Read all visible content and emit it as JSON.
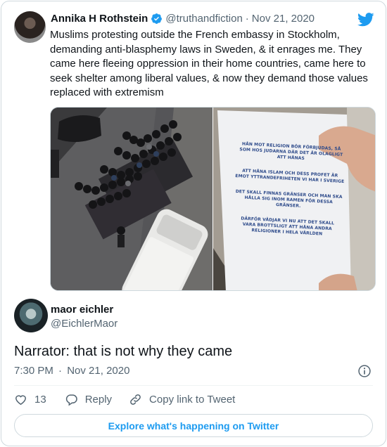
{
  "quoted_tweet": {
    "author_name": "Annika H Rothstein",
    "handle": "@truthandfiction",
    "separator": "·",
    "date": "Nov 21, 2020",
    "text": "Muslims protesting outside the French embassy in Stockholm, demanding anti-blasphemy laws in Sweden, & it enrages me. They came here fleeing oppression in their home countries, came here to seek shelter among liberal values, & now they demand those values replaced with extremism",
    "sign_text": [
      "HÅN MOT RELIGION BÖR FÖRBJUDAS, SÅ",
      "SOM HOS JUDARNA DÄR DET ÄR OLAGLIGT",
      "ATT HÅNAS",
      "ATT HÅNA ISLAM OCH DESS PROFET ÄR",
      "EMOT YTTRANDEFRIHETEN VI HAR I SVERIGE",
      "DET SKALL FINNAS GRÄNSER OCH MAN SKA",
      "HÅLLA SIG INOM RAMEN FÖR DESSA",
      "GRÄNSER.",
      "DÄRFÖR VÄDJAR VI NU ATT DET SKALL",
      "VARA BROTTSLIGT ATT HÅNA ANDRA",
      "RELIGIONER I HELA VÄRLDEN"
    ]
  },
  "reply_tweet": {
    "author_name": "maor eichler",
    "handle": "@EichlerMaor",
    "text": "Narrator: that is not why they came",
    "time": "7:30 PM",
    "separator": "·",
    "date": "Nov 21, 2020"
  },
  "actions": {
    "like_count": "13",
    "reply_label": "Reply",
    "copy_link_label": "Copy link to Tweet"
  },
  "explore_label": "Explore what's happening on Twitter",
  "colors": {
    "accent": "#1d9bf0",
    "secondary_text": "#536471",
    "primary_text": "#0f1419",
    "border": "#cfd9de"
  },
  "icons": [
    "verified-badge-icon",
    "twitter-bird-icon",
    "info-icon",
    "heart-icon",
    "reply-icon",
    "link-icon"
  ]
}
